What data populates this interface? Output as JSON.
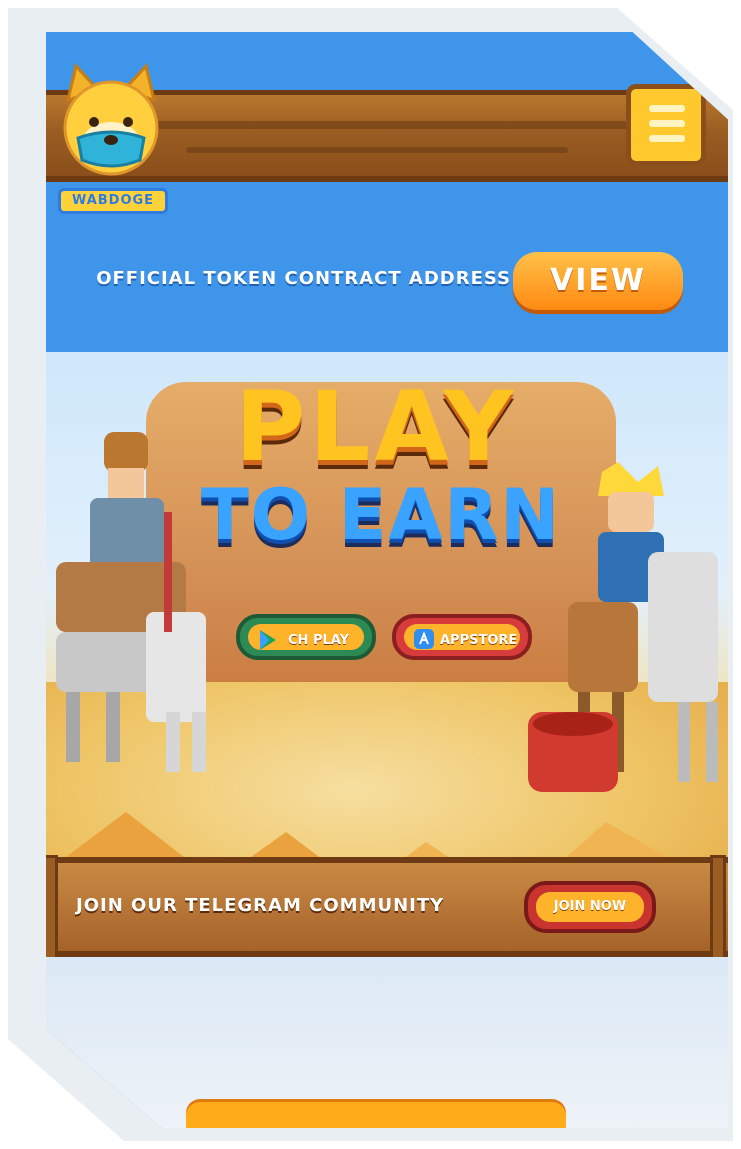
{
  "header": {
    "logo_text": "WABDOGE",
    "menu_icon": "hamburger-menu-icon"
  },
  "contract": {
    "label": "OFFICIAL TOKEN CONTRACT ADDRESS",
    "button": "VIEW"
  },
  "hero": {
    "title_line1": "PLAY",
    "title_line2": "TO EARN",
    "store_buttons": [
      {
        "label": "CH PLAY",
        "icon": "google-play-icon"
      },
      {
        "label": "APPSTORE",
        "icon": "app-store-icon"
      }
    ]
  },
  "telegram": {
    "label": "JOIN OUR TELEGRAM COMMUNITY",
    "button": "JOIN NOW"
  },
  "colors": {
    "sky_blue": "#3f95ea",
    "wood": "#9a5d22",
    "orange": "#ff8a12",
    "yellow": "#ffc41f"
  }
}
